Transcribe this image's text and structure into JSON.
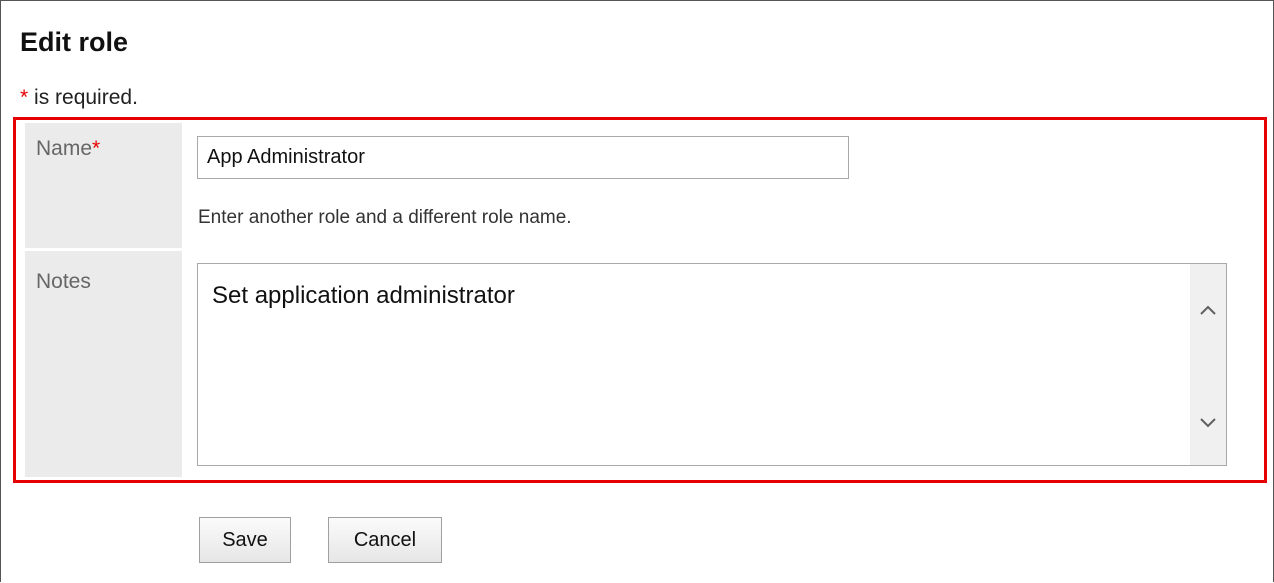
{
  "page": {
    "title": "Edit role",
    "required_star": "*",
    "required_text": " is required."
  },
  "form": {
    "name": {
      "label": "Name",
      "required_star": "*",
      "value": "App Administrator",
      "hint": "Enter another role and a different role name."
    },
    "notes": {
      "label": "Notes",
      "value": "Set application administrator"
    }
  },
  "buttons": {
    "save_label": "Save",
    "cancel_label": "Cancel"
  },
  "icons": {
    "scroll_up": "chevron-up-icon",
    "scroll_down": "chevron-down-icon"
  },
  "colors": {
    "required": "#e60000",
    "highlight_border": "#e60000",
    "label_background": "#ebebeb"
  }
}
